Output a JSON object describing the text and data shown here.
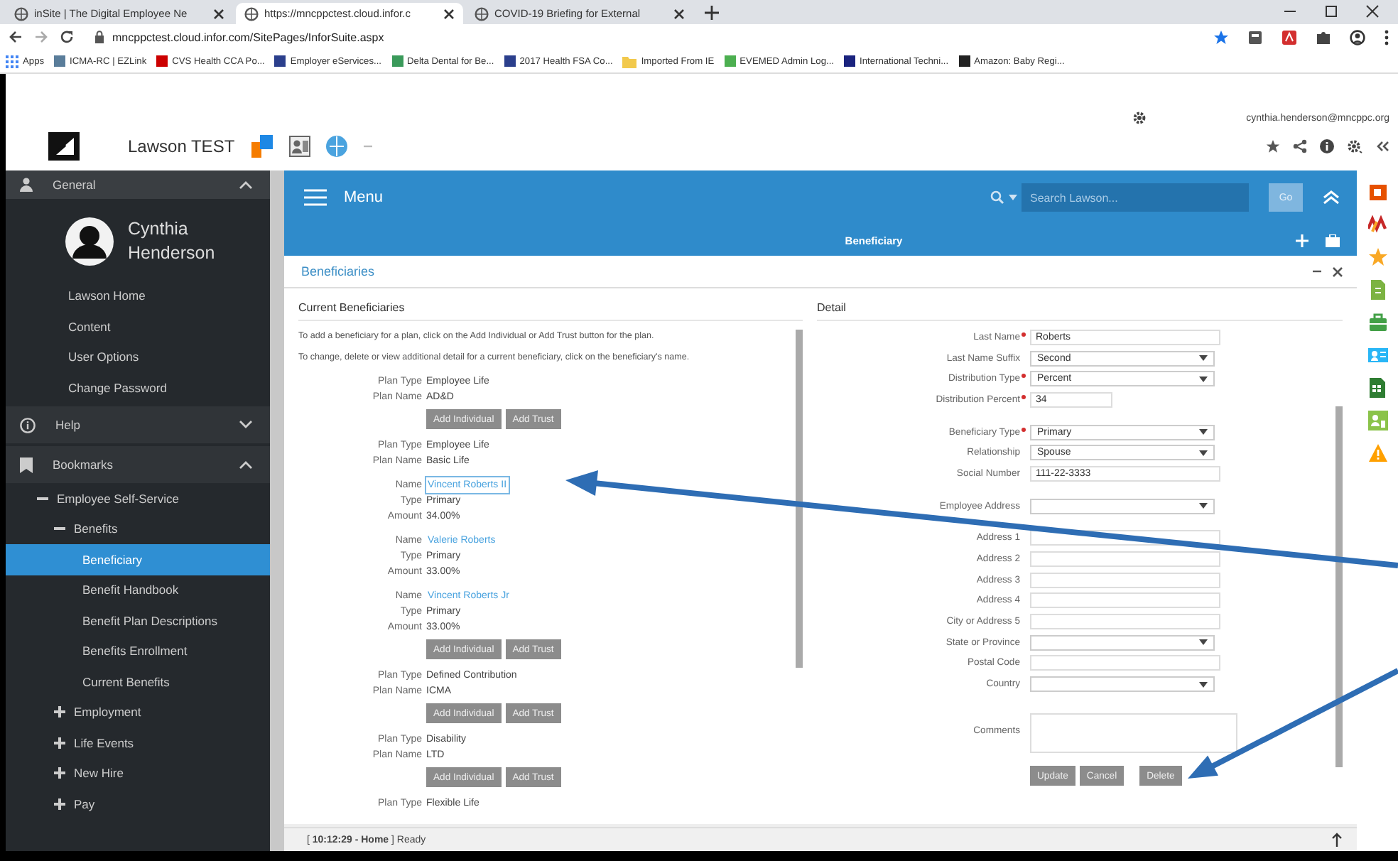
{
  "browser": {
    "tabs": [
      {
        "title": "inSite | The Digital Employee Ne",
        "selected": false
      },
      {
        "title": "https://mncppctest.cloud.infor.c",
        "selected": true
      },
      {
        "title": "COVID-19 Briefing for External",
        "selected": false
      }
    ],
    "url": "mncppctest.cloud.infor.com/SitePages/InforSuite.aspx",
    "bookmarks": [
      {
        "label": "Apps",
        "kind": "apps"
      },
      {
        "label": "ICMA-RC | EZLink",
        "kind": "site",
        "color": "#5a7d9a"
      },
      {
        "label": "CVS Health CCA Po...",
        "kind": "site",
        "color": "#cc0000"
      },
      {
        "label": "Employer eServices...",
        "kind": "site",
        "color": "#2b3f8c"
      },
      {
        "label": "Delta Dental for Be...",
        "kind": "site",
        "color": "#3a9a5a"
      },
      {
        "label": "2017 Health FSA Co...",
        "kind": "site",
        "color": "#2b3f8c"
      },
      {
        "label": "Imported From IE",
        "kind": "folder",
        "color": "#f2c94c"
      },
      {
        "label": "EVEMED Admin Log...",
        "kind": "site",
        "color": "#4caf50"
      },
      {
        "label": "International Techni...",
        "kind": "site",
        "color": "#1a237e"
      },
      {
        "label": "Amazon: Baby Regi...",
        "kind": "site",
        "color": "#222222"
      }
    ]
  },
  "app": {
    "title": "Lawson TEST",
    "user": "cynthia.henderson@mncppc.org"
  },
  "sidebar": {
    "general": {
      "label": "General",
      "expanded": true
    },
    "user_name": "Cynthia Henderson",
    "items": [
      "Lawson Home",
      "Content",
      "User Options",
      "Change Password"
    ],
    "sections": [
      {
        "label": "Help",
        "expanded": false,
        "kind": "help"
      },
      {
        "label": "Bookmarks",
        "expanded": true,
        "kind": "bookmark"
      }
    ],
    "tree": [
      {
        "label": "Employee Self-Service",
        "expanded": true,
        "selected": false,
        "children": [
          {
            "label": "Benefits",
            "expanded": true,
            "selected": false,
            "children": [
              {
                "label": "Beneficiary",
                "selected": true
              },
              {
                "label": "Benefit Handbook",
                "selected": false
              },
              {
                "label": "Benefit Plan Descriptions",
                "selected": false
              },
              {
                "label": "Benefits Enrollment",
                "selected": false
              },
              {
                "label": "Current Benefits",
                "selected": false
              }
            ]
          },
          {
            "label": "Employment",
            "expanded": false,
            "selected": false
          },
          {
            "label": "Life Events",
            "expanded": false,
            "selected": false
          },
          {
            "label": "New Hire",
            "expanded": false,
            "selected": false
          },
          {
            "label": "Pay",
            "expanded": false,
            "selected": false
          }
        ]
      }
    ]
  },
  "menu_bar": {
    "label": "Menu",
    "search": {
      "placeholder": "Search Lawson..."
    },
    "go": "Go"
  },
  "sub_bar": {
    "title": "Beneficiary"
  },
  "panel": {
    "title": "Beneficiaries",
    "current": {
      "title": "Current Beneficiaries",
      "instructions": [
        "To add a beneficiary for a plan, click on the Add Individual or Add Trust button for the plan.",
        "To change, delete or view additional detail for a current beneficiary, click on the beneficiary's name."
      ],
      "plans": [
        {
          "rows": [
            {
              "label": "Plan Type",
              "value": "Employee Life"
            },
            {
              "label": "Plan Name",
              "value": "AD&D"
            }
          ],
          "buttons": [
            "Add Individual",
            "Add Trust"
          ]
        },
        {
          "rows": [
            {
              "label": "Plan Type",
              "value": "Employee Life"
            },
            {
              "label": "Plan Name",
              "value": "Basic Life"
            }
          ],
          "beneficiaries": [
            {
              "name_label": "Name",
              "name": "Vincent Roberts II",
              "selected": true,
              "rows": [
                {
                  "label": "Type",
                  "value": "Primary"
                },
                {
                  "label": "Amount",
                  "value": "34.00%"
                }
              ]
            },
            {
              "name_label": "Name",
              "name": "Valerie Roberts",
              "selected": false,
              "rows": [
                {
                  "label": "Type",
                  "value": "Primary"
                },
                {
                  "label": "Amount",
                  "value": "33.00%"
                }
              ]
            },
            {
              "name_label": "Name",
              "name": "Vincent Roberts Jr",
              "selected": false,
              "rows": [
                {
                  "label": "Type",
                  "value": "Primary"
                },
                {
                  "label": "Amount",
                  "value": "33.00%"
                }
              ]
            }
          ],
          "buttons": [
            "Add Individual",
            "Add Trust"
          ]
        },
        {
          "rows": [
            {
              "label": "Plan Type",
              "value": "Defined Contribution"
            },
            {
              "label": "Plan Name",
              "value": "ICMA"
            }
          ],
          "buttons": [
            "Add Individual",
            "Add Trust"
          ]
        },
        {
          "rows": [
            {
              "label": "Plan Type",
              "value": "Disability"
            },
            {
              "label": "Plan Name",
              "value": "LTD"
            }
          ],
          "buttons": [
            "Add Individual",
            "Add Trust"
          ]
        },
        {
          "rows": [
            {
              "label": "Plan Type",
              "value": "Flexible Life"
            }
          ]
        }
      ]
    },
    "detail": {
      "title": "Detail",
      "groups": [
        [
          {
            "label": "Last Name",
            "required": true,
            "kind": "text",
            "value": "Roberts"
          },
          {
            "label": "Last Name Suffix",
            "required": false,
            "kind": "select",
            "value": "Second"
          },
          {
            "label": "Distribution Type",
            "required": true,
            "kind": "select",
            "value": "Percent"
          },
          {
            "label": "Distribution Percent",
            "required": true,
            "kind": "short",
            "value": "34"
          }
        ],
        [
          {
            "label": "Beneficiary Type",
            "required": true,
            "kind": "select",
            "value": "Primary"
          },
          {
            "label": "Relationship",
            "required": false,
            "kind": "select",
            "value": "Spouse"
          },
          {
            "label": "Social Number",
            "required": false,
            "kind": "text",
            "value": "111-22-3333"
          }
        ],
        [
          {
            "label": "Employee Address",
            "required": false,
            "kind": "select"
          }
        ],
        [
          {
            "label": "Address 1",
            "required": false,
            "kind": "text"
          },
          {
            "label": "Address 2",
            "required": false,
            "kind": "text"
          },
          {
            "label": "Address 3",
            "required": false,
            "kind": "text"
          },
          {
            "label": "Address 4",
            "required": false,
            "kind": "text"
          },
          {
            "label": "City or Address 5",
            "required": false,
            "kind": "text"
          },
          {
            "label": "State or Province",
            "required": false,
            "kind": "select"
          },
          {
            "label": "Postal Code",
            "required": false,
            "kind": "text"
          },
          {
            "label": "Country",
            "required": false,
            "kind": "select"
          }
        ],
        [
          {
            "label": "Comments",
            "required": false,
            "kind": "textarea"
          }
        ]
      ],
      "buttons": [
        "Update",
        "Cancel",
        "Delete"
      ]
    }
  },
  "status_bar": {
    "text": "[ **10:12:29 - Home** ] Ready"
  }
}
